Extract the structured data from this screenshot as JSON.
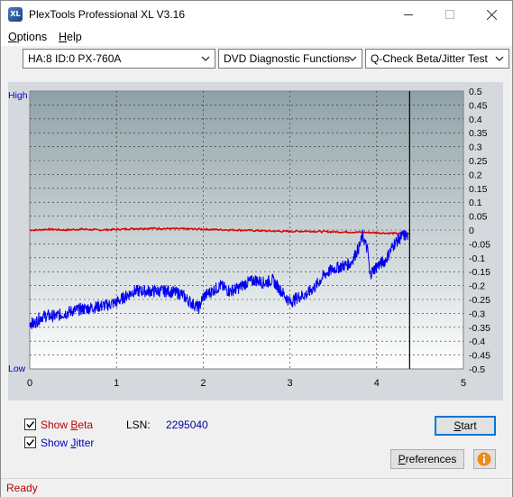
{
  "window": {
    "title": "PlexTools Professional XL V3.16",
    "icon_label": "XL"
  },
  "menu": {
    "options": {
      "first": "O",
      "rest": "ptions"
    },
    "help": {
      "first": "H",
      "rest": "elp"
    }
  },
  "toolbar": {
    "drive": "HA:8 ID:0  PX-760A",
    "function": "DVD Diagnostic Functions",
    "test": "Q-Check Beta/Jitter Test"
  },
  "chart_data": {
    "type": "line",
    "left_axis": {
      "top_label": "High",
      "bottom_label": "Low"
    },
    "x": {
      "lim": [
        0,
        5
      ],
      "ticks": [
        "0",
        "1",
        "2",
        "3",
        "4",
        "5"
      ]
    },
    "y": {
      "lim": [
        -0.5,
        0.5
      ],
      "ticks": [
        "0.5",
        "0.45",
        "0.4",
        "0.35",
        "0.3",
        "0.25",
        "0.2",
        "0.15",
        "0.1",
        "0.05",
        "0",
        "-0.05",
        "-0.1",
        "-0.15",
        "-0.2",
        "-0.25",
        "-0.3",
        "-0.35",
        "-0.4",
        "-0.45",
        "-0.5"
      ]
    },
    "end_marker_x": 4.38,
    "grid": true,
    "colors": {
      "beta": "#e00000",
      "jitter": "#0000ee",
      "plot_top": "#8fa2a8",
      "plot_bottom": "#ffffff"
    },
    "series": [
      {
        "name": "Beta",
        "color": "#e00000",
        "x": [
          0,
          0.1,
          0.2,
          0.4,
          0.6,
          0.8,
          1.0,
          1.2,
          1.4,
          1.6,
          1.8,
          2.0,
          2.2,
          2.4,
          2.6,
          2.8,
          3.0,
          3.2,
          3.4,
          3.6,
          3.8,
          3.9,
          4.0,
          4.1,
          4.2,
          4.3,
          4.38
        ],
        "y": [
          0.0,
          0.0,
          0.003,
          0.0,
          0.003,
          0.0,
          0.002,
          0.005,
          0.006,
          0.005,
          0.004,
          0.003,
          0.001,
          0.0,
          -0.002,
          -0.004,
          -0.005,
          -0.004,
          -0.006,
          -0.007,
          -0.008,
          -0.009,
          -0.01,
          -0.011,
          -0.012,
          -0.013,
          -0.014
        ]
      },
      {
        "name": "Jitter",
        "color": "#0000ee",
        "x": [
          0,
          0.05,
          0.1,
          0.15,
          0.3,
          0.5,
          0.7,
          0.9,
          1.0,
          1.1,
          1.2,
          1.4,
          1.6,
          1.75,
          1.85,
          1.95,
          2.0,
          2.1,
          2.2,
          2.3,
          2.4,
          2.5,
          2.6,
          2.7,
          2.8,
          2.9,
          3.0,
          3.1,
          3.2,
          3.3,
          3.4,
          3.5,
          3.6,
          3.7,
          3.8,
          3.84,
          3.9,
          3.92,
          3.95,
          4.0,
          4.1,
          4.2,
          4.3,
          4.36
        ],
        "y": [
          -0.33,
          -0.34,
          -0.32,
          -0.31,
          -0.31,
          -0.29,
          -0.28,
          -0.27,
          -0.26,
          -0.24,
          -0.22,
          -0.22,
          -0.22,
          -0.23,
          -0.26,
          -0.28,
          -0.24,
          -0.22,
          -0.2,
          -0.22,
          -0.21,
          -0.19,
          -0.18,
          -0.19,
          -0.18,
          -0.22,
          -0.26,
          -0.24,
          -0.23,
          -0.2,
          -0.16,
          -0.14,
          -0.13,
          -0.12,
          -0.06,
          -0.02,
          -0.08,
          -0.16,
          -0.15,
          -0.13,
          -0.11,
          -0.05,
          -0.02,
          -0.02
        ]
      }
    ]
  },
  "controls": {
    "show_beta": {
      "label_first": "Show ",
      "label_u": "B",
      "label_rest": "eta",
      "checked": true,
      "color": "#c00000"
    },
    "show_jitter": {
      "label_first": "Show ",
      "label_u": "J",
      "label_rest": "itter",
      "checked": true,
      "color": "#0000c0"
    },
    "lsn_label": "LSN:",
    "lsn_value": "2295040",
    "start": {
      "first": "",
      "u": "S",
      "rest": "tart"
    },
    "preferences": {
      "first": "",
      "u": "P",
      "rest": "references"
    }
  },
  "status": {
    "text": "Ready"
  }
}
